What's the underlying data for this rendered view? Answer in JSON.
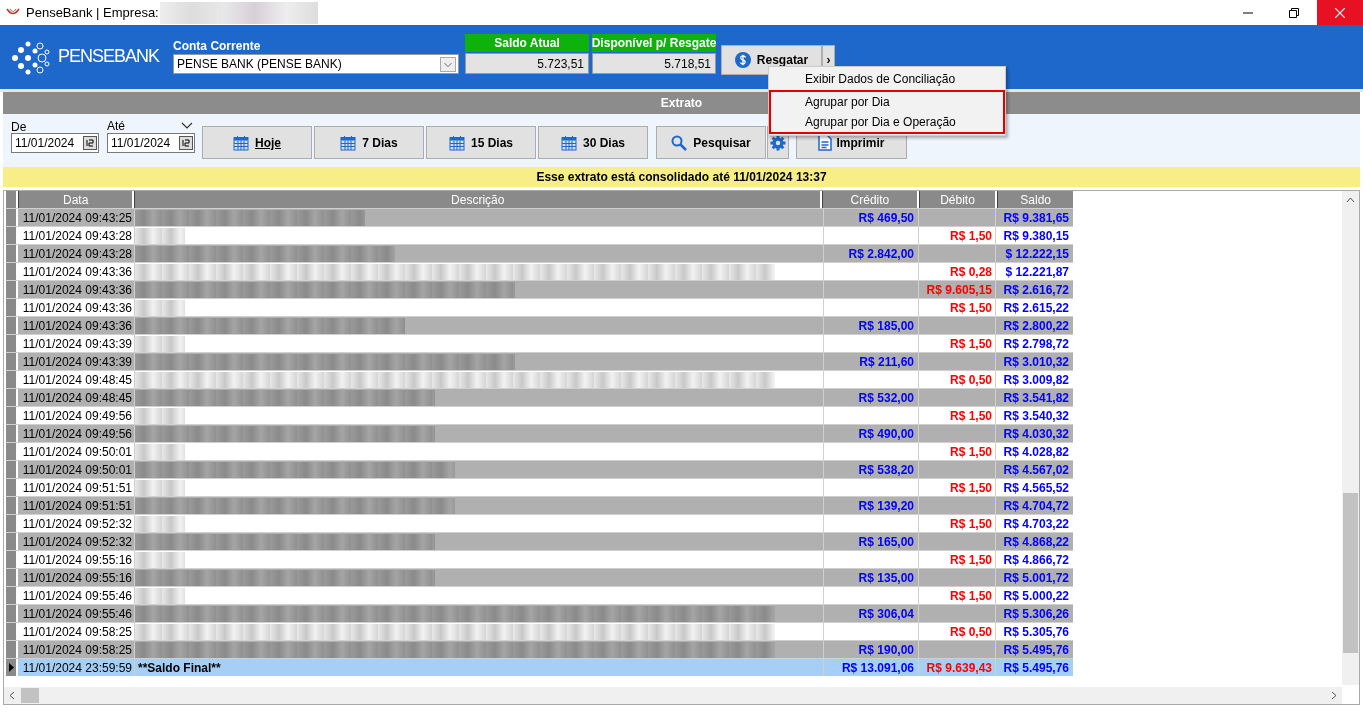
{
  "window": {
    "title": "PenseBank | Empresa:"
  },
  "header": {
    "logo_text": "PENSEBANK",
    "account_label": "Conta Corrente",
    "account_value": "PENSE BANK (PENSE BANK)",
    "balances": [
      {
        "label": "Saldo Atual",
        "value": "5.723,51"
      },
      {
        "label": "Disponível p/ Resgate",
        "value": "5.718,51"
      }
    ],
    "resgatar_button": "Resgatar",
    "more_button": "›"
  },
  "menu": [
    {
      "label": "Exibir Dados de Conciliação",
      "highlighted": false
    },
    {
      "label": "Agrupar por Dia",
      "highlighted": true
    },
    {
      "label": "Agrupar por Dia e Operação",
      "highlighted": true
    }
  ],
  "section_title": "Extrato",
  "filters": {
    "from_label": "De",
    "from_value": "11/01/2024",
    "to_label": "Até",
    "to_value": "11/01/2024",
    "period_buttons": [
      {
        "label": "Hoje",
        "underlined": true
      },
      {
        "label": "7 Dias",
        "underlined": false
      },
      {
        "label": "15 Dias",
        "underlined": false
      },
      {
        "label": "30 Dias",
        "underlined": false
      }
    ],
    "search_button": "Pesquisar",
    "print_button": "Imprimir"
  },
  "notice": "Esse extrato está consolidado até 11/01/2024 13:37",
  "table": {
    "columns": [
      "Data",
      "Descrição",
      "Crédito",
      "Débito",
      "Saldo"
    ],
    "rows": [
      {
        "date": "11/01/2024 09:43:25",
        "credit": "R$ 469,50",
        "debit": "",
        "balance": "R$ 9.381,65",
        "selected": false
      },
      {
        "date": "11/01/2024 09:43:28",
        "credit": "",
        "debit": "R$ 1,50",
        "balance": "R$ 9.380,15",
        "selected": false
      },
      {
        "date": "11/01/2024 09:43:28",
        "credit": "R$ 2.842,00",
        "debit": "",
        "balance": "$ 12.222,15",
        "selected": false
      },
      {
        "date": "11/01/2024 09:43:36",
        "credit": "",
        "debit": "R$ 0,28",
        "balance": "$ 12.221,87",
        "selected": false
      },
      {
        "date": "11/01/2024 09:43:36",
        "credit": "",
        "debit": "R$ 9.605,15",
        "balance": "R$ 2.616,72",
        "selected": false
      },
      {
        "date": "11/01/2024 09:43:36",
        "credit": "",
        "debit": "R$ 1,50",
        "balance": "R$ 2.615,22",
        "selected": false
      },
      {
        "date": "11/01/2024 09:43:36",
        "credit": "R$ 185,00",
        "debit": "",
        "balance": "R$ 2.800,22",
        "selected": false
      },
      {
        "date": "11/01/2024 09:43:39",
        "credit": "",
        "debit": "R$ 1,50",
        "balance": "R$ 2.798,72",
        "selected": false
      },
      {
        "date": "11/01/2024 09:43:39",
        "credit": "R$ 211,60",
        "debit": "",
        "balance": "R$ 3.010,32",
        "selected": false
      },
      {
        "date": "11/01/2024 09:48:45",
        "credit": "",
        "debit": "R$ 0,50",
        "balance": "R$ 3.009,82",
        "selected": false
      },
      {
        "date": "11/01/2024 09:48:45",
        "credit": "R$ 532,00",
        "debit": "",
        "balance": "R$ 3.541,82",
        "selected": false
      },
      {
        "date": "11/01/2024 09:49:56",
        "credit": "",
        "debit": "R$ 1,50",
        "balance": "R$ 3.540,32",
        "selected": false
      },
      {
        "date": "11/01/2024 09:49:56",
        "credit": "R$ 490,00",
        "debit": "",
        "balance": "R$ 4.030,32",
        "selected": false
      },
      {
        "date": "11/01/2024 09:50:01",
        "credit": "",
        "debit": "R$ 1,50",
        "balance": "R$ 4.028,82",
        "selected": false
      },
      {
        "date": "11/01/2024 09:50:01",
        "credit": "R$ 538,20",
        "debit": "",
        "balance": "R$ 4.567,02",
        "selected": false
      },
      {
        "date": "11/01/2024 09:51:51",
        "credit": "",
        "debit": "R$ 1,50",
        "balance": "R$ 4.565,52",
        "selected": false
      },
      {
        "date": "11/01/2024 09:51:51",
        "credit": "R$ 139,20",
        "debit": "",
        "balance": "R$ 4.704,72",
        "selected": false
      },
      {
        "date": "11/01/2024 09:52:32",
        "credit": "",
        "debit": "R$ 1,50",
        "balance": "R$ 4.703,22",
        "selected": false
      },
      {
        "date": "11/01/2024 09:52:32",
        "credit": "R$ 165,00",
        "debit": "",
        "balance": "R$ 4.868,22",
        "selected": false
      },
      {
        "date": "11/01/2024 09:55:16",
        "credit": "",
        "debit": "R$ 1,50",
        "balance": "R$ 4.866,72",
        "selected": false
      },
      {
        "date": "11/01/2024 09:55:16",
        "credit": "R$ 135,00",
        "debit": "",
        "balance": "R$ 5.001,72",
        "selected": false
      },
      {
        "date": "11/01/2024 09:55:46",
        "credit": "",
        "debit": "R$ 1,50",
        "balance": "R$ 5.000,22",
        "selected": false
      },
      {
        "date": "11/01/2024 09:55:46",
        "credit": "R$ 306,04",
        "debit": "",
        "balance": "R$ 5.306,26",
        "selected": false
      },
      {
        "date": "11/01/2024 09:58:25",
        "credit": "",
        "debit": "R$ 0,50",
        "balance": "R$ 5.305,76",
        "selected": false
      },
      {
        "date": "11/01/2024 09:58:25",
        "credit": "R$ 190,00",
        "debit": "",
        "balance": "R$ 5.495,76",
        "selected": false
      },
      {
        "date": "11/01/2024 23:59:59",
        "description": "**Saldo Final**",
        "credit": "R$ 13.091,06",
        "debit": "R$ 9.639,43",
        "balance": "R$ 5.495,76",
        "selected": true
      }
    ]
  }
}
